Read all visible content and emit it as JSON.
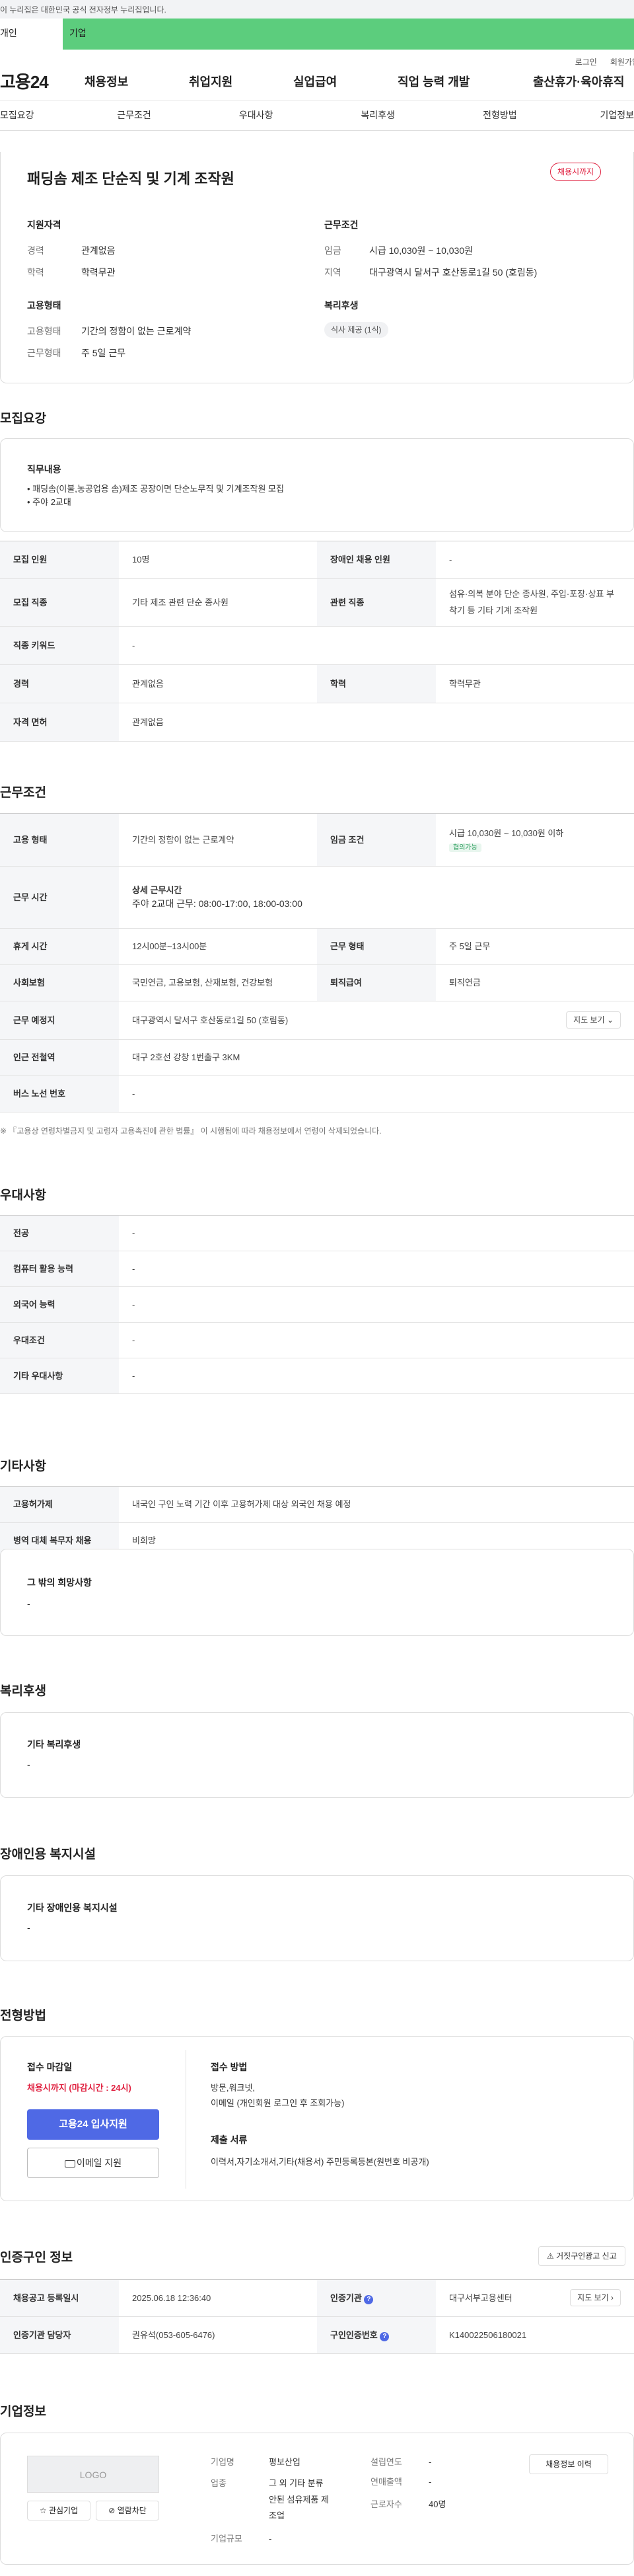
{
  "gov_banner": "이 누리집은 대한민국 공식 전자정부 누리집입니다.",
  "seg_tabs": [
    "개인",
    "기업"
  ],
  "util_links": [
    "로그인",
    "회원가입"
  ],
  "logo": "고용24",
  "gnb": [
    "채용정보",
    "취업지원",
    "실업급여",
    "직업 능력 개발",
    "출산휴가·육아휴직"
  ],
  "tabs": [
    "모집요강",
    "근무조건",
    "우대사항",
    "복리후생",
    "전형방법",
    "기업정보"
  ],
  "job": {
    "title": "패딩솜 제조 단순직 및 기계 조작원",
    "status_badge": "채용시까지",
    "qual_title": "지원자격",
    "qual": [
      {
        "k": "경력",
        "v": "관계없음"
      },
      {
        "k": "학력",
        "v": "학력무관"
      }
    ],
    "cond_title": "근무조건",
    "cond": [
      {
        "k": "임금",
        "v": "시급 10,030원 ~ 10,030원"
      },
      {
        "k": "지역",
        "v": "대구광역시 달서구 호산동로1길 50 (호림동)"
      }
    ],
    "emp_title": "고용형태",
    "emp": [
      {
        "k": "고용형태",
        "v": "기간의 정함이 없는 근로계약"
      },
      {
        "k": "근무형태",
        "v": "주 5일 근무"
      }
    ],
    "welfare_title": "복리후생",
    "welfare_chip": "식사 제공 (1식)"
  },
  "recruit": {
    "title": "모집요강",
    "duty_title": "직무내용",
    "duty_lines": [
      "• 패딩솜(이불,농공업용 솜)제조 공장이면 단순노무직 및 기계조작원 모집",
      "• 주야 2교대"
    ],
    "rows": [
      [
        "모집 인원",
        "10명",
        "장애인 채용 인원",
        "-"
      ],
      [
        "모집 직종",
        "기타 제조 관련 단순 종사원",
        "관련 직종",
        "섬유·의복 분야 단순 종사원, 주입·포장·상표 부착기 등 기타 기계 조작원"
      ],
      [
        "직종 키워드",
        "-",
        "",
        ""
      ],
      [
        "경력",
        "관계없음",
        "학력",
        "학력무관"
      ],
      [
        "자격 면허",
        "관계없음",
        "",
        ""
      ]
    ]
  },
  "work": {
    "title": "근무조건",
    "emp_type_k": "고용 형태",
    "emp_type_v": "기간의 정함이 없는 근로계약",
    "wage_k": "임금 조건",
    "wage_v": "시급 10,030원 ~ 10,030원 이하",
    "wage_tag": "협의가능",
    "hours_k": "근무 시간",
    "hours_sub": "상세 근무시간",
    "hours_v": "주야 2교대 근무: 08:00-17:00, 18:00-03:00",
    "rest_k": "휴게 시간",
    "rest_v": "12시00분~13시00분",
    "form_k": "근무 형태",
    "form_v": "주 5일 근무",
    "ins_k": "사회보험",
    "ins_v": "국민연금, 고용보험, 산재보험, 건강보험",
    "sev_k": "퇴직급여",
    "sev_v": "퇴직연금",
    "place_k": "근무 예정지",
    "place_v": "대구광역시 달서구 호산동로1길 50 (호림동)",
    "map_btn": "지도 보기",
    "station_k": "인근 전철역",
    "station_v": "대구 2호선 강창 1번출구 3KM",
    "bus_k": "버스 노선 번호",
    "bus_v": "-",
    "note": "※ 『고용상 연령차별금지 및 고령자 고용촉진에 관한 법률』 이 시행됨에 따라 채용정보에서 연령이 삭제되었습니다."
  },
  "prefer": {
    "title": "우대사항",
    "rows": [
      [
        "전공",
        "-"
      ],
      [
        "컴퓨터 활용 능력",
        "-"
      ],
      [
        "외국어 능력",
        "-"
      ],
      [
        "우대조건",
        "-"
      ],
      [
        "기타 우대사항",
        "-"
      ]
    ]
  },
  "etc": {
    "title": "기타사항",
    "rows": [
      [
        "고용허가제",
        "내국인 구인 노력 기간 이후 고용허가제 대상 외국인 채용 예정"
      ],
      [
        "병역 대체 복무자 채용",
        "비희망"
      ]
    ],
    "other_title": "그 밖의 희망사항",
    "other_v": "-"
  },
  "benefit": {
    "title": "복리후생",
    "inner": "기타 복리후생",
    "v": "-"
  },
  "disabled": {
    "title": "장애인용 복지시설",
    "inner": "기타 장애인용 복지시설",
    "v": "-"
  },
  "process": {
    "title": "전형방법",
    "deadline_k": "접수 마감일",
    "deadline_v": "채용시까지 (마감시간 : 24시)",
    "apply_btn": "고용24 입사지원",
    "email_btn": "이메일 지원",
    "method_k": "접수 방법",
    "method_v1": "방문,워크넷,",
    "method_v2": "이메일 (개인회원 로그인 후 조회가능)",
    "docs_k": "제출 서류",
    "docs_v": "이력서,자기소개서,기타(채용서) 주민등록등본(원번호 비공개)"
  },
  "cert": {
    "title": "인증구인 정보",
    "report_btn": "거짓구인광고 신고",
    "reg_k": "채용공고 등록일시",
    "reg_v": "2025.06.18 12:36:40",
    "org_k": "인증기관",
    "org_v": "대구서부고용센터",
    "map_btn": "지도 보기",
    "mgr_k": "인증기관 담당자",
    "mgr_v": "권유석(053-605-6476)",
    "no_k": "구인인증번호",
    "no_v": "K140022506180021"
  },
  "company": {
    "title": "기업정보",
    "logo_text": "LOGO",
    "fav_btn": "관심기업",
    "block_btn": "열람차단",
    "history_btn": "채용정보 이력",
    "name_k": "기업명",
    "name_v": "평보산업",
    "ind_k": "업종",
    "ind_v1": "그 외 기타 분류",
    "ind_v2": "안된 섬유제품 제",
    "ind_v3": "조업",
    "size_k": "기업규모",
    "size_v": "-",
    "year_k": "설립연도",
    "year_v": "-",
    "sales_k": "연매출액",
    "sales_v": "-",
    "emp_k": "근로자수",
    "emp_v": "40명"
  }
}
